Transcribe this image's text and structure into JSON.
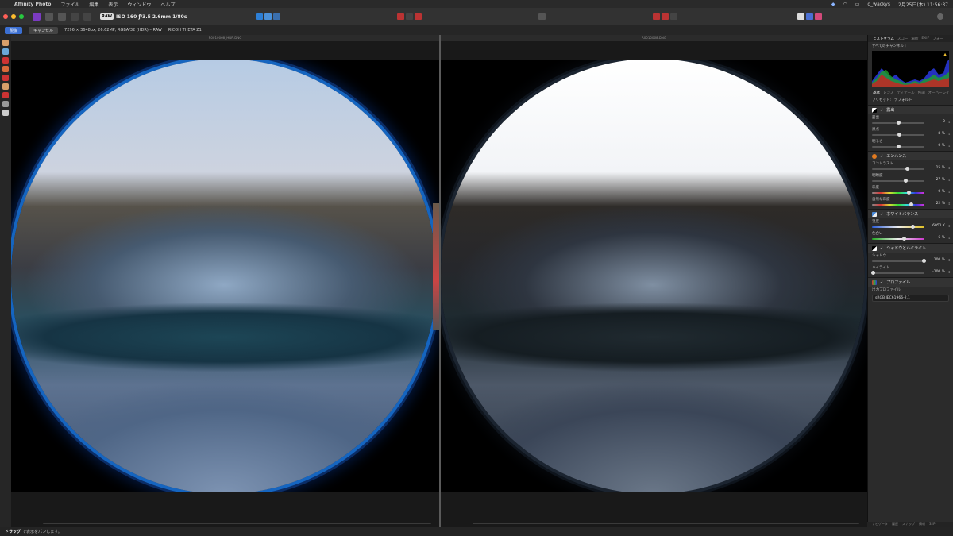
{
  "menubar": {
    "app_name": "Affinity Photo",
    "menus": [
      "ファイル",
      "編集",
      "表示",
      "ウィンドウ",
      "ヘルプ"
    ],
    "user": "d_wackys",
    "datetime": "2月25日(木)  11:56:37"
  },
  "toolbar": {
    "raw_badge": "RAW",
    "camera_info": "ISO 160 ƒ/3.5 2.6mm 1/80s"
  },
  "context": {
    "apply_label": "現像",
    "cancel_label": "キャンセル",
    "image_info": "7296 × 3648px, 26.62MP, RGBA/32 (HDR) – RAW",
    "camera_model": "RICOH THETA Z1"
  },
  "documents": {
    "left_title": "R0010068_HDR.DNG",
    "right_title": "R0010068.DNG"
  },
  "panel": {
    "tabs": [
      "ヒストグラム",
      "スコー",
      "場所",
      "EXIF",
      "フォー"
    ],
    "active_tab": "ヒストグラム",
    "channel_select": "すべてのチャンネル ⁝",
    "sub_tabs": [
      "基本",
      "レンズ",
      "ディテール",
      "色調",
      "オーバーレイ"
    ],
    "preset_label": "プリセット:",
    "preset_value": "デフォルト",
    "sections": [
      {
        "title": "露出",
        "sliders": [
          {
            "label": "露出",
            "value": "0"
          },
          {
            "label": "黒点",
            "value": "8 %"
          },
          {
            "label": "明るさ",
            "value": "0 %"
          }
        ]
      },
      {
        "title": "エンハンス",
        "sliders": [
          {
            "label": "コントラスト",
            "value": "15 %"
          },
          {
            "label": "明瞭度",
            "value": "27 %"
          },
          {
            "label": "彩度",
            "value": "0 %"
          },
          {
            "label": "自然な彩度",
            "value": "22 %"
          }
        ]
      },
      {
        "title": "ホワイトバランス",
        "sliders": [
          {
            "label": "温度",
            "value": "6051 K"
          },
          {
            "label": "色合い",
            "value": "6 %"
          }
        ]
      },
      {
        "title": "シャドウとハイライト",
        "sliders": [
          {
            "label": "シャドウ",
            "value": "100 %"
          },
          {
            "label": "ハイライト",
            "value": "-100 %"
          }
        ]
      },
      {
        "title": "プロファイル",
        "sliders": []
      }
    ],
    "output_profile_label": "出力プロファイル",
    "output_profile_value": "sRGB IEC61966-2.1",
    "bottom_tabs": [
      "ナビゲータ",
      "履歴",
      "スナップ",
      "情報",
      "32P"
    ]
  },
  "status": {
    "bold": "ドラッグ",
    "text": "で表示をパンします。"
  },
  "slider_positions": {
    "section0": [
      0.5,
      0.52,
      0.5
    ],
    "section1": [
      0.68,
      0.65,
      0.7,
      0.75
    ],
    "section2": [
      0.78,
      0.62
    ],
    "section3": [
      0.99,
      0.02
    ]
  },
  "colors": {
    "accent": "#3b6fd2",
    "traffic_red": "#ff5f57",
    "traffic_yellow": "#febc2e",
    "traffic_green": "#28c840"
  }
}
